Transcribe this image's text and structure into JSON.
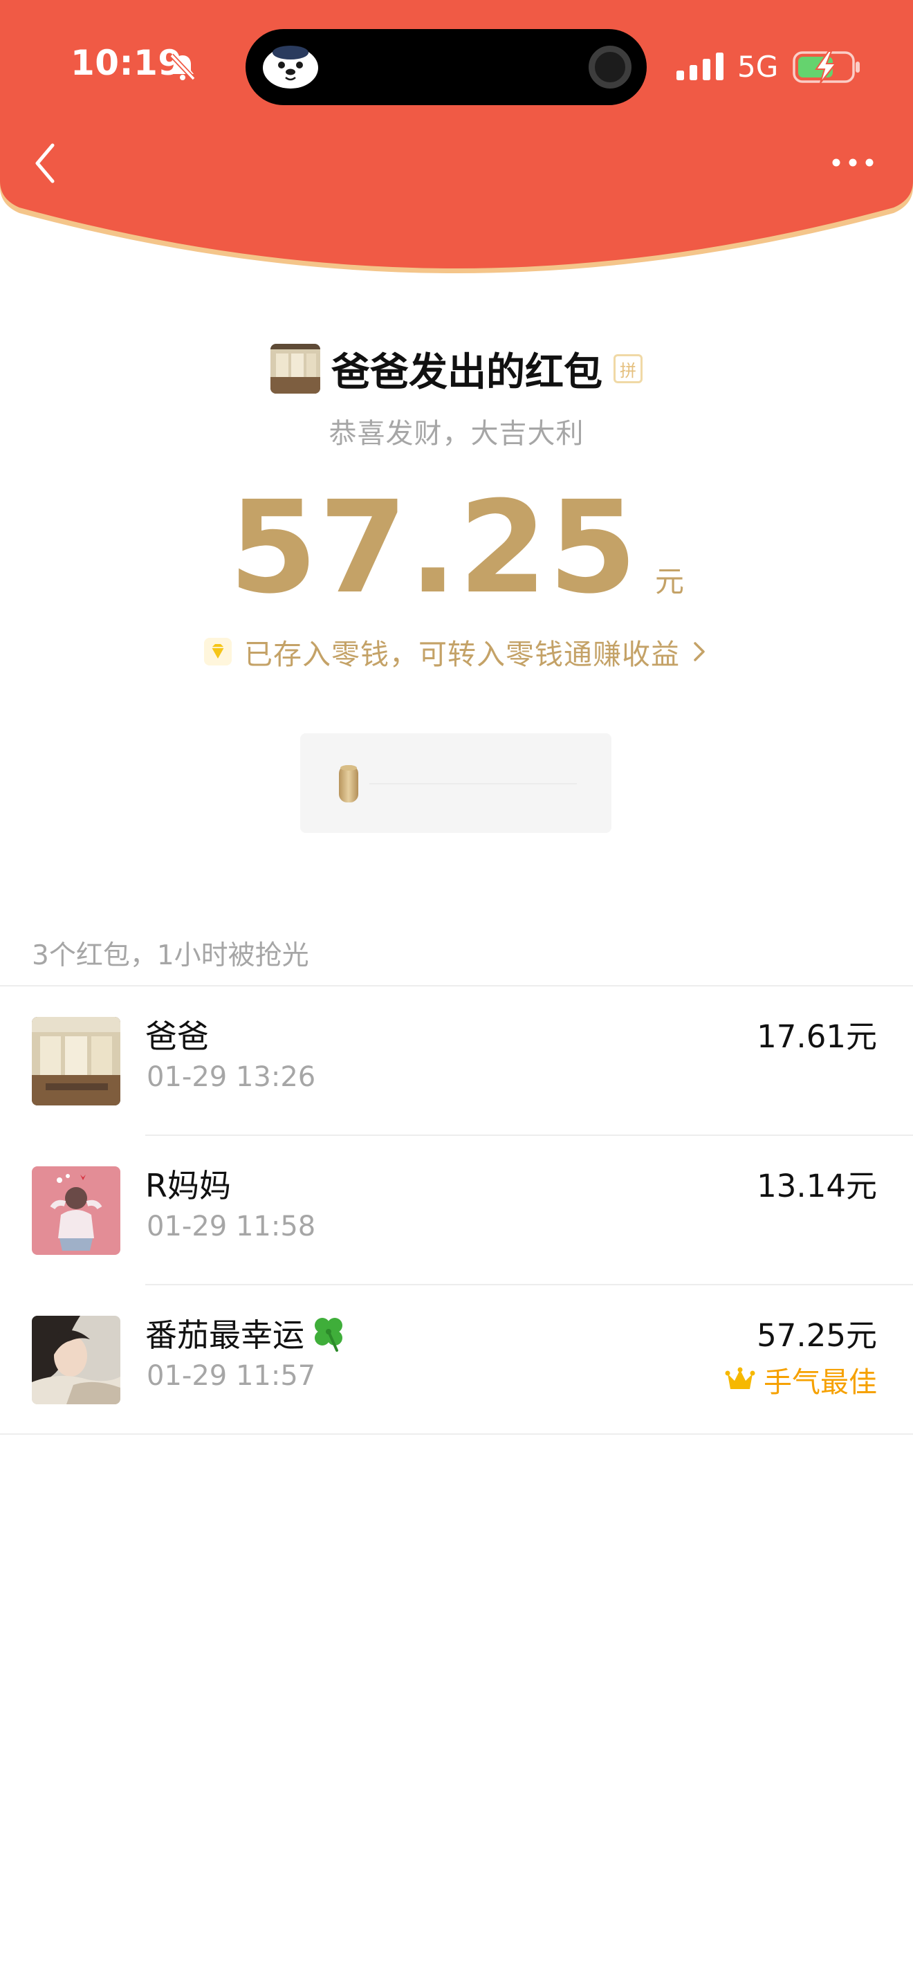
{
  "status_bar": {
    "time": "10:19",
    "network": "5G"
  },
  "header": {
    "accent_color": "#f05a45",
    "rim_color": "#f4c58a"
  },
  "envelope": {
    "sender_title": "爸爸发出的红包",
    "pin_badge": "拼",
    "greeting": "恭喜发财，大吉大利",
    "amount": "57.25",
    "amount_unit": "元",
    "saved_notice": "已存入零钱，可转入零钱通赚收益",
    "gold_color": "#c4a267"
  },
  "list": {
    "summary": "3个红包，1小时被抢光",
    "items": [
      {
        "name": "爸爸",
        "time": "01-29 13:26",
        "amount": "17.61元"
      },
      {
        "name": "R妈妈",
        "time": "01-29 11:58",
        "amount": "13.14元"
      },
      {
        "name": "番茄最幸运",
        "time": "01-29 11:57",
        "amount": "57.25元",
        "badge": "手气最佳"
      }
    ]
  },
  "icons": {
    "back": "chevron-left-icon",
    "more": "more-icon",
    "saved": "diamond-icon",
    "best_luck": "crown-icon",
    "name_suffix": "clover-icon"
  }
}
